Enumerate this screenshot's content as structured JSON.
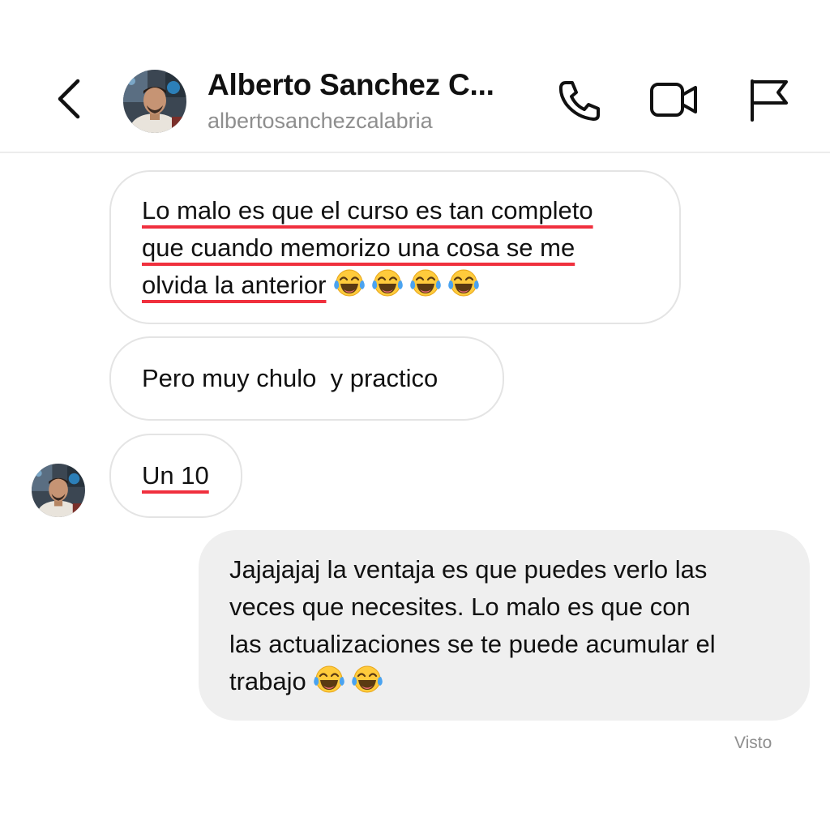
{
  "header": {
    "name": "Alberto Sanchez C...",
    "username": "albertosanchezcalabria",
    "icons": [
      "back-chevron-icon",
      "phone-icon",
      "video-camera-icon",
      "flag-icon"
    ]
  },
  "messages": [
    {
      "direction": "incoming",
      "lines": [
        "Lo malo es que el curso es tan completo",
        "que cuando memorizo una cosa se me",
        "olvida la anterior"
      ],
      "emoji": [
        "face-with-tears-of-joy",
        "face-with-tears-of-joy",
        "face-with-tears-of-joy",
        "face-with-tears-of-joy"
      ],
      "underlined": true
    },
    {
      "direction": "incoming",
      "text": "Pero muy chulo  y practico"
    },
    {
      "direction": "incoming",
      "text": "Un 10",
      "underlined": true,
      "show_avatar": true
    },
    {
      "direction": "outgoing",
      "lines": [
        "Jajajajaj la ventaja es que puedes verlo las",
        "veces que necesites. Lo malo es que con",
        "las actualizaciones se te puede acumular el",
        "trabajo"
      ],
      "emoji": [
        "face-with-tears-of-joy",
        "face-with-tears-of-joy"
      ]
    }
  ],
  "status": {
    "seen_label": "Visto"
  },
  "colors": {
    "underline": "#f0303e",
    "outgoing_bubble": "#efefef",
    "incoming_border": "#e4e4e4",
    "secondary_text": "#8e8e8e"
  }
}
